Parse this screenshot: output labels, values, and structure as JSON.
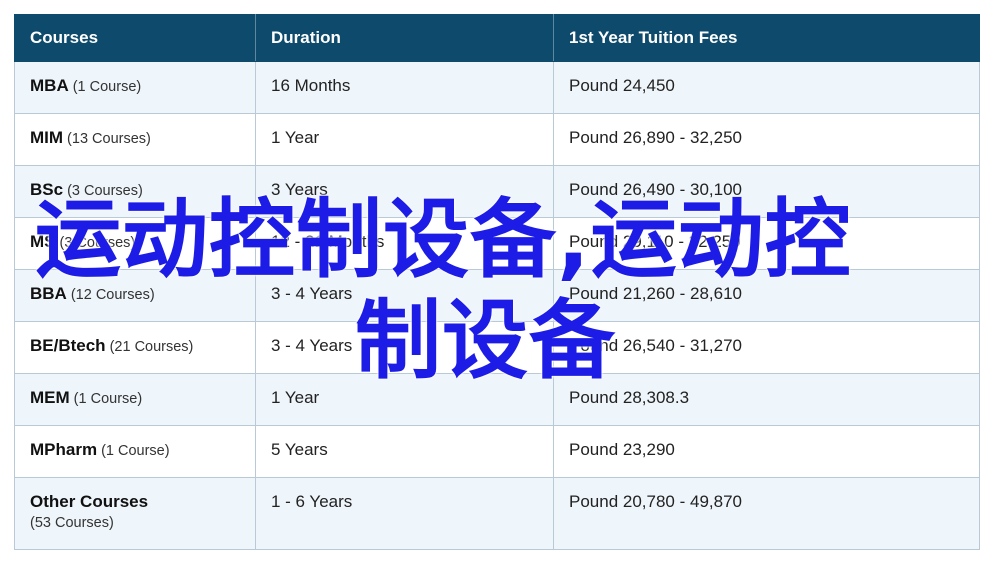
{
  "table": {
    "headers": [
      "Courses",
      "Duration",
      "1st Year Tuition Fees"
    ],
    "rows": [
      {
        "name": "MBA",
        "count": "(1 Course)",
        "duration": "16 Months",
        "fees": "Pound 24,450"
      },
      {
        "name": "MIM",
        "count": "(13 Courses)",
        "duration": "1 Year",
        "fees": "Pound 26,890 - 32,250"
      },
      {
        "name": "BSc",
        "count": "(3 Courses)",
        "duration": "3 Years",
        "fees": "Pound 26,490 - 30,100"
      },
      {
        "name": "MS",
        "count": "(3 Courses)",
        "duration": "12 - 21 Months",
        "fees": "Pound 29,110 - 32,250"
      },
      {
        "name": "BBA",
        "count": "(12 Courses)",
        "duration": "3 - 4 Years",
        "fees": "Pound 21,260 - 28,610"
      },
      {
        "name": "BE/Btech",
        "count": "(21 Courses)",
        "duration": "3 - 4 Years",
        "fees": "Pound 26,540 - 31,270"
      },
      {
        "name": "MEM",
        "count": "(1 Course)",
        "duration": "1 Year",
        "fees": "Pound 28,308.3"
      },
      {
        "name": "MPharm",
        "count": "(1 Course)",
        "duration": "5 Years",
        "fees": "Pound 23,290"
      },
      {
        "name": "Other Courses",
        "count": "(53 Courses)",
        "duration": "1 - 6 Years",
        "fees": "Pound 20,780 - 49,870"
      }
    ]
  },
  "watermark": {
    "line1": "运动控制设备,运动控",
    "line2": "制设备",
    "color": "#1c1ce6"
  },
  "colors": {
    "header_bg": "#0d4a6b",
    "row_alt_bg": "#eef5fb",
    "border": "#b9cad6"
  }
}
